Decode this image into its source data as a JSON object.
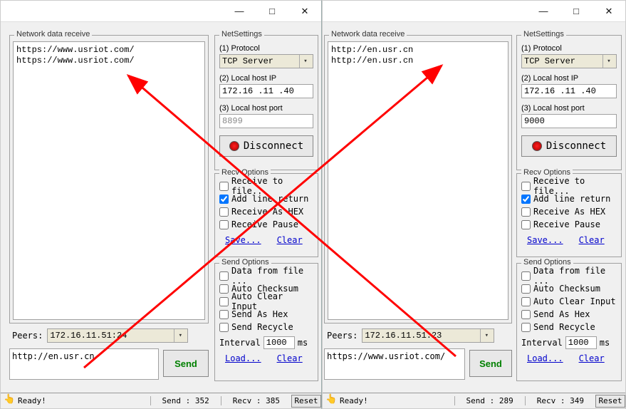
{
  "left": {
    "recv_group_title": "Network data receive",
    "recv_lines": [
      "https://www.usriot.com/",
      "https://www.usriot.com/"
    ],
    "netsettings": {
      "group_title": "NetSettings",
      "protocol_label": "(1) Protocol",
      "protocol_value": "TCP Server",
      "localip_label": "(2) Local host IP",
      "localip_value": "172.16 .11 .40",
      "localport_label": "(3) Local host port",
      "localport_value": "8899",
      "disconnect_label": "Disconnect"
    },
    "recv_options": {
      "group_title": "Recv Options",
      "receive_to_file": "Receive to file...",
      "add_line_return": "Add line return",
      "receive_as_hex": "Receive As HEX",
      "receive_pause": "Receive Pause",
      "save_link": "Save...",
      "clear_link": "Clear"
    },
    "send_options": {
      "group_title": "Send Options",
      "data_from_file": "Data from file ...",
      "auto_checksum": "Auto Checksum",
      "auto_clear_input": "Auto Clear Input",
      "send_as_hex": "Send As Hex",
      "send_recycle": "Send Recycle",
      "interval_label": "Interval",
      "interval_value": "1000",
      "interval_unit": "ms",
      "load_link": "Load...",
      "clear_link": "Clear"
    },
    "peers_label": "Peers:",
    "peers_value": "172.16.11.51:24",
    "send_text": "http://en.usr.cn",
    "send_button": "Send",
    "status": {
      "ready": "Ready!",
      "send_count": "Send : 352",
      "recv_count": "Recv : 385",
      "reset": "Reset"
    }
  },
  "right": {
    "recv_group_title": "Network data receive",
    "recv_lines": [
      "http://en.usr.cn",
      "http://en.usr.cn"
    ],
    "netsettings": {
      "group_title": "NetSettings",
      "protocol_label": "(1) Protocol",
      "protocol_value": "TCP Server",
      "localip_label": "(2) Local host IP",
      "localip_value": "172.16 .11 .40",
      "localport_label": "(3) Local host port",
      "localport_value": "9000",
      "disconnect_label": "Disconnect"
    },
    "recv_options": {
      "group_title": "Recv Options",
      "receive_to_file": "Receive to file...",
      "add_line_return": "Add line return",
      "receive_as_hex": "Receive As HEX",
      "receive_pause": "Receive Pause",
      "save_link": "Save...",
      "clear_link": "Clear"
    },
    "send_options": {
      "group_title": "Send Options",
      "data_from_file": "Data from file ...",
      "auto_checksum": "Auto Checksum",
      "auto_clear_input": "Auto Clear Input",
      "send_as_hex": "Send As Hex",
      "send_recycle": "Send Recycle",
      "interval_label": "Interval",
      "interval_value": "1000",
      "interval_unit": "ms",
      "load_link": "Load...",
      "clear_link": "Clear"
    },
    "peers_label": "Peers:",
    "peers_value": "172.16.11.51:23",
    "send_text": "https://www.usriot.com/",
    "send_button": "Send",
    "status": {
      "ready": "Ready!",
      "send_count": "Send : 289",
      "recv_count": "Recv : 349",
      "reset": "Reset"
    }
  }
}
